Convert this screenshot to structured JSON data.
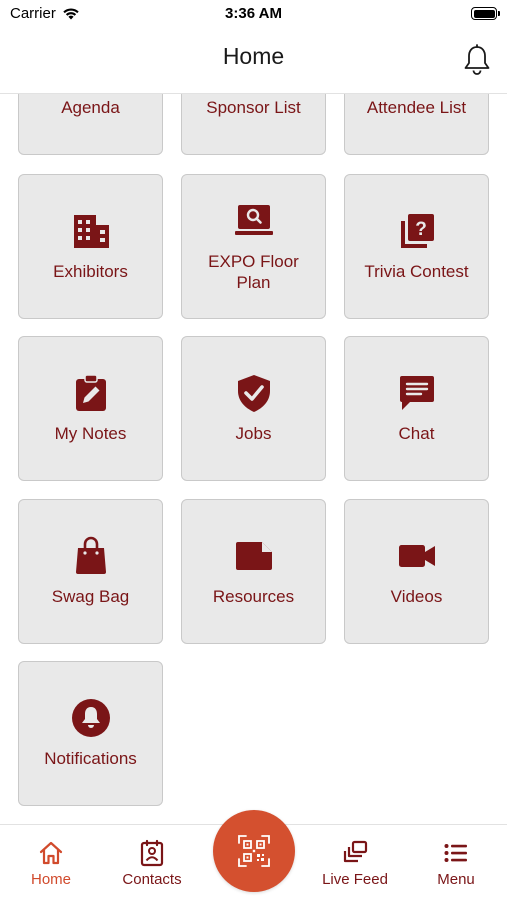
{
  "status_bar": {
    "carrier": "Carrier",
    "time": "3:36 AM"
  },
  "header": {
    "title": "Home"
  },
  "tiles": [
    {
      "label": "Agenda"
    },
    {
      "label": "Sponsor List"
    },
    {
      "label": "Attendee List"
    },
    {
      "label": "Exhibitors",
      "icon": "building-icon"
    },
    {
      "label": "EXPO Floor Plan",
      "icon": "laptop-search-icon"
    },
    {
      "label": "Trivia Contest",
      "icon": "question-cards-icon"
    },
    {
      "label": "My Notes",
      "icon": "clipboard-pencil-icon"
    },
    {
      "label": "Jobs",
      "icon": "shield-check-icon"
    },
    {
      "label": "Chat",
      "icon": "chat-bubble-icon"
    },
    {
      "label": "Swag Bag",
      "icon": "shopping-bag-icon"
    },
    {
      "label": "Resources",
      "icon": "file-icon"
    },
    {
      "label": "Videos",
      "icon": "video-camera-icon"
    },
    {
      "label": "Notifications",
      "icon": "bell-circle-icon"
    }
  ],
  "tab_bar": {
    "items": [
      {
        "label": "Home",
        "icon": "home-icon",
        "active": true
      },
      {
        "label": "Contacts",
        "icon": "contact-card-icon",
        "active": false
      },
      {
        "label": "Live Feed",
        "icon": "stacked-cards-icon",
        "active": false
      },
      {
        "label": "Menu",
        "icon": "list-menu-icon",
        "active": false
      }
    ],
    "scan_icon": "qr-scan-icon"
  },
  "colors": {
    "brand": "#7a1517",
    "accent": "#d4502f",
    "tile_bg": "#e9e9e9"
  }
}
